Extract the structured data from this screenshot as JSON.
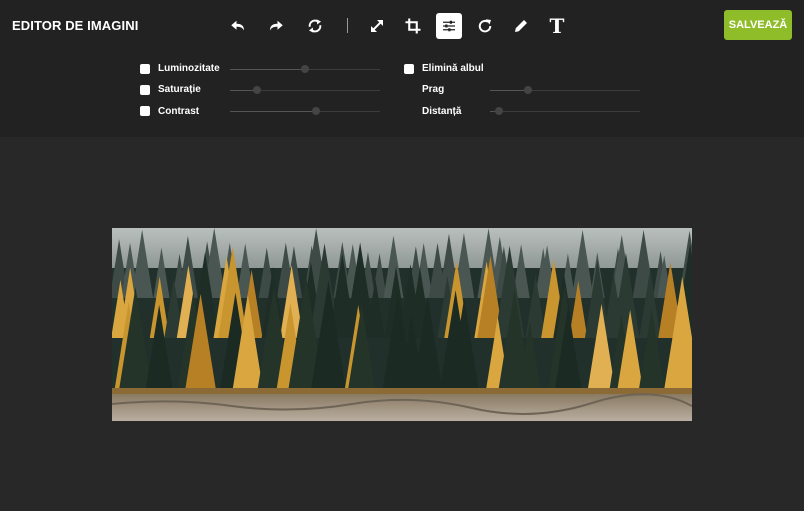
{
  "header": {
    "title": "EDITOR DE IMAGINI",
    "save_label": "SALVEAZĂ",
    "tools": [
      {
        "name": "undo-icon",
        "active": false
      },
      {
        "name": "redo-icon",
        "active": false
      },
      {
        "name": "reset-icon",
        "active": false
      },
      {
        "name": "resize-icon",
        "active": false
      },
      {
        "name": "crop-icon",
        "active": false
      },
      {
        "name": "adjust-icon",
        "active": true
      },
      {
        "name": "rotate-icon",
        "active": false
      },
      {
        "name": "draw-icon",
        "active": false
      },
      {
        "name": "text-icon",
        "active": false
      }
    ],
    "text_tool_glyph": "T"
  },
  "adjustments": {
    "brightness": {
      "label": "Luminozitate",
      "value": 0.5
    },
    "saturation": {
      "label": "Saturație",
      "value": 0.18
    },
    "contrast": {
      "label": "Contrast",
      "value": 0.57
    },
    "remove_white": {
      "label": "Elimină albul"
    },
    "threshold": {
      "label": "Prag",
      "value": 0.25
    },
    "distance": {
      "label": "Distanță",
      "value": 0.06
    }
  },
  "colors": {
    "accent": "#8fbd2a",
    "toolbar_bg": "#222222",
    "workspace_bg": "#282828"
  }
}
